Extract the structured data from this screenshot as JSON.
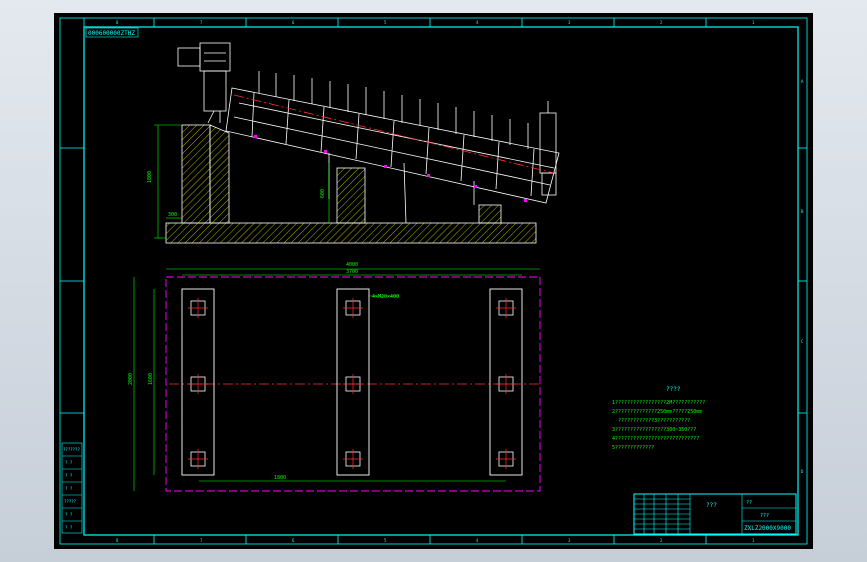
{
  "drawing": {
    "code_top": "000600000ZTHZ",
    "code_bottom": "ZXLZ2000X9000",
    "title_label": "???",
    "title_cell_mid": "???",
    "title_cell_sheet": "??",
    "notes_heading": "????",
    "notes": [
      "1?????????????????2M???????????",
      "2??????????????250mm?????250mm",
      "????????????3???????????",
      "3?????????????????300~350???",
      "4????????????????????????????",
      "5?????????????"
    ],
    "left_table": [
      "???????",
      "? ?",
      "? ?",
      "? ?",
      "?????",
      "? ?",
      "? ?"
    ],
    "dims": {
      "total_length": "4000",
      "inner_length": "3700",
      "total_width": "2000",
      "inner_width": "1600",
      "span": "1800",
      "left_height": "1800",
      "mid_height": "600",
      "pad": "300",
      "callout": "4×M20×400"
    },
    "colors": {
      "background": "#000000",
      "frame": "#00ffff",
      "dimension": "#00ff00",
      "hatch": "#ffff00",
      "center": "#ff0000",
      "outline": "#ff00ff",
      "machine": "#ffffff"
    }
  }
}
